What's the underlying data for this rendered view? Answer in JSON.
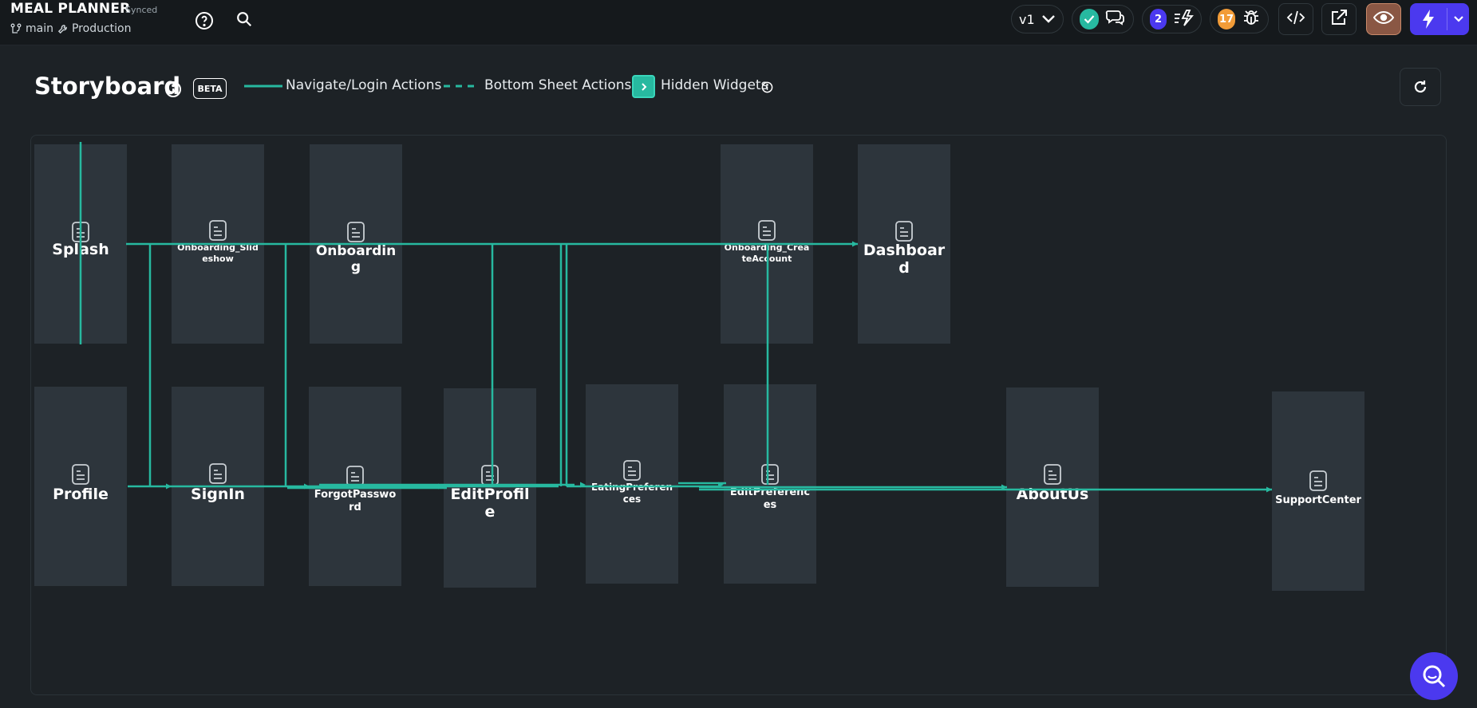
{
  "topbar": {
    "project_name": "MEAL PLANNER",
    "sync_status": "Synced",
    "branch": "main",
    "environment": "Production",
    "version_label": "v1",
    "notifications_count": "2",
    "issues_count": "17",
    "colors": {
      "accent": "#4b39ef",
      "success": "#27b9a0",
      "warning": "#f29c38",
      "preview_bg": "#8a5744"
    }
  },
  "header": {
    "title": "Storyboard",
    "beta_label": "BETA",
    "legend": {
      "navigate": "Navigate/Login Actions",
      "bottom_sheet": "Bottom Sheet Actions",
      "hidden_widgets": "Hidden Widgets"
    }
  },
  "pages": [
    {
      "name": "Splash"
    },
    {
      "name": "Onboarding_Slideshow"
    },
    {
      "name": "Onboarding"
    },
    {
      "name": "Onboarding_CreateAccount"
    },
    {
      "name": "Dashboard"
    },
    {
      "name": "Profile"
    },
    {
      "name": "SignIn"
    },
    {
      "name": "ForgotPassword"
    },
    {
      "name": "EditProfile"
    },
    {
      "name": "EatingPreferences"
    },
    {
      "name": "EditPreferences"
    },
    {
      "name": "AboutUs"
    },
    {
      "name": "SupportCenter"
    }
  ],
  "wire_color": "#27b9a0"
}
